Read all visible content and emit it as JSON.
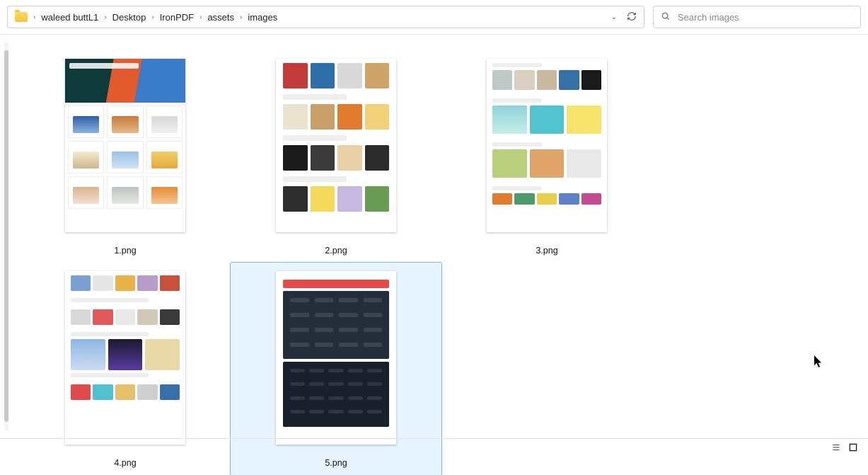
{
  "breadcrumbs": {
    "c0": "waleed buttL1",
    "c1": "Desktop",
    "c2": "IronPDF",
    "c3": "assets",
    "c4": "images"
  },
  "search": {
    "placeholder": "Search images"
  },
  "files": {
    "f1": "1.png",
    "f2": "2.png",
    "f3": "3.png",
    "f4": "4.png",
    "f5": "5.png"
  }
}
